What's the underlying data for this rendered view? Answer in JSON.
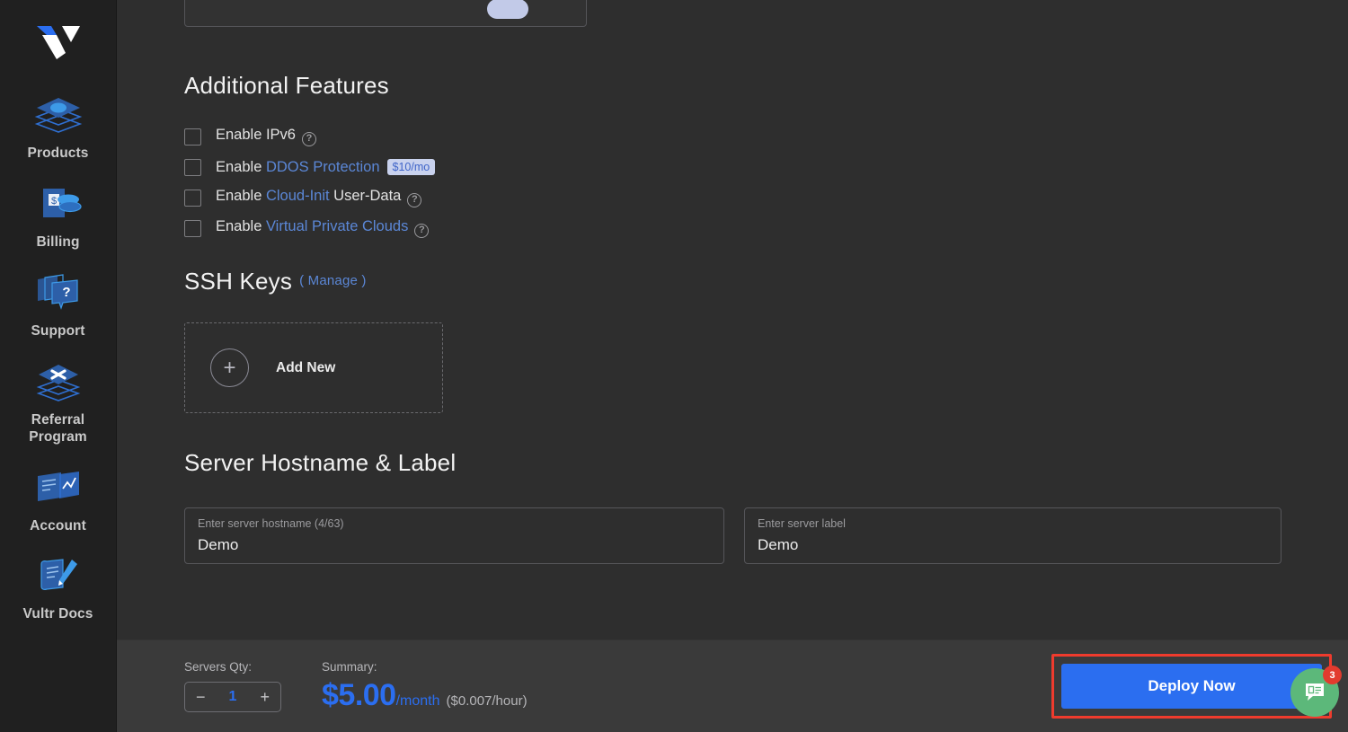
{
  "sidebar": {
    "logo_name": "vultr-logo",
    "items": [
      {
        "label": "Products",
        "icon": "layers-icon"
      },
      {
        "label": "Billing",
        "icon": "invoice-coins-icon"
      },
      {
        "label": "Support",
        "icon": "support-question-icon"
      },
      {
        "label": "Referral Program",
        "icon": "layers-star-icon"
      },
      {
        "label": "Account",
        "icon": "account-card-icon"
      },
      {
        "label": "Vultr Docs",
        "icon": "docs-pencil-icon"
      }
    ]
  },
  "main": {
    "additional_features": {
      "title": "Additional Features",
      "items": [
        {
          "prefix": "Enable ",
          "link": "",
          "suffix": "IPv6",
          "help": "?",
          "badge": "",
          "checked": false
        },
        {
          "prefix": "Enable ",
          "link": "DDOS Protection",
          "suffix": "",
          "help": "",
          "badge": "$10/mo",
          "checked": false
        },
        {
          "prefix": "Enable ",
          "link": "Cloud-Init",
          "suffix": " User-Data",
          "help": "?",
          "badge": "",
          "checked": false
        },
        {
          "prefix": "Enable ",
          "link": "Virtual Private Clouds",
          "suffix": "",
          "help": "?",
          "badge": "",
          "checked": false
        }
      ]
    },
    "ssh_keys": {
      "title": "SSH Keys",
      "manage_label": "( Manage )",
      "add_new_label": "Add New",
      "plus_glyph": "+"
    },
    "hostname_label": {
      "title": "Server Hostname & Label",
      "hostname_placeholder": "Enter server hostname (4/63)",
      "hostname_value": "Demo",
      "label_placeholder": "Enter server label",
      "label_value": "Demo"
    }
  },
  "bottom_bar": {
    "qty_caption": "Servers Qty:",
    "qty_value": "1",
    "minus_glyph": "−",
    "plus_glyph": "+",
    "summary_caption": "Summary:",
    "price_amount": "$5.00",
    "price_period": "/month",
    "price_hourly": "($0.007/hour)",
    "deploy_label": "Deploy Now"
  },
  "chat": {
    "badge_count": "3",
    "icon": "chat-bubble-icon"
  },
  "colors": {
    "accent_blue": "#2b6ef0",
    "link_blue": "#5b87d6",
    "highlight_red": "#ef3b2d",
    "chat_green": "#5cb87a",
    "badge_red": "#e23b2e",
    "sidebar_bg": "#202020",
    "main_bg": "#2e2e2e",
    "bottom_bar_bg": "#3a3a3a"
  }
}
